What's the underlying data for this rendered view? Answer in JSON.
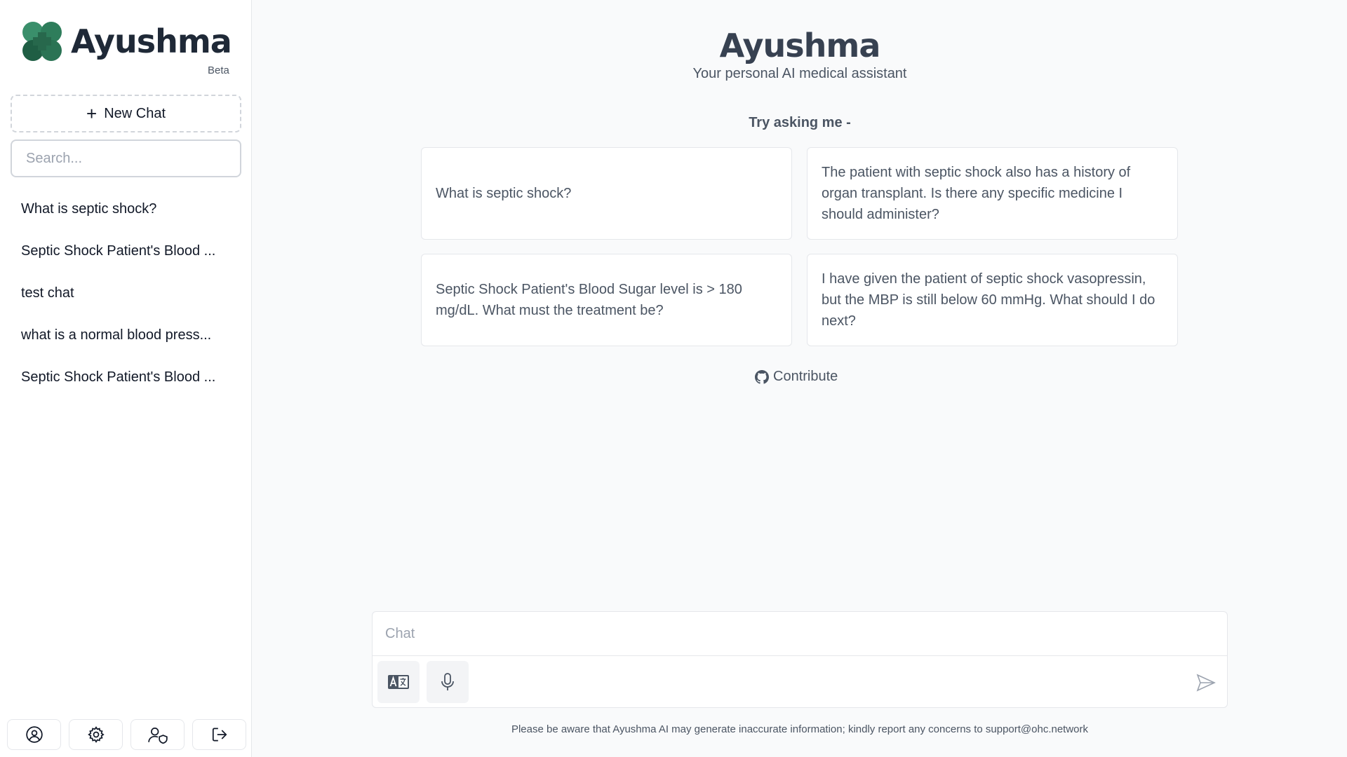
{
  "sidebar": {
    "logo_text": "Ayushma",
    "beta_label": "Beta",
    "new_chat_label": "New Chat",
    "search_placeholder": "Search...",
    "history": [
      "What is septic shock?",
      "Septic Shock Patient's Blood ...",
      "test chat",
      "what is a normal blood press...",
      "Septic Shock Patient's Blood ..."
    ],
    "bottom_icons": [
      "user-circle-icon",
      "gear-icon",
      "user-shield-icon",
      "logout-icon"
    ]
  },
  "main": {
    "title": "Ayushma",
    "subtitle": "Your personal AI medical assistant",
    "try_label": "Try asking me -",
    "prompts": [
      "What is septic shock?",
      "The patient with septic shock also has a history of organ transplant. Is there any specific medicine I should administer?",
      "Septic Shock Patient's Blood Sugar level is > 180 mg/dL. What must the treatment be?",
      "I have given the patient of septic shock vasopressin, but the MBP is still below 60 mmHg. What should I do next?"
    ],
    "contribute_label": "Contribute",
    "chat_placeholder": "Chat",
    "disclaimer": "Please be aware that Ayushma AI may generate inaccurate information; kindly report any concerns to support@ohc.network"
  },
  "colors": {
    "brand_green": "#2e7d5b",
    "brand_dark_green": "#1f5e44",
    "background": "#f9fafb"
  }
}
